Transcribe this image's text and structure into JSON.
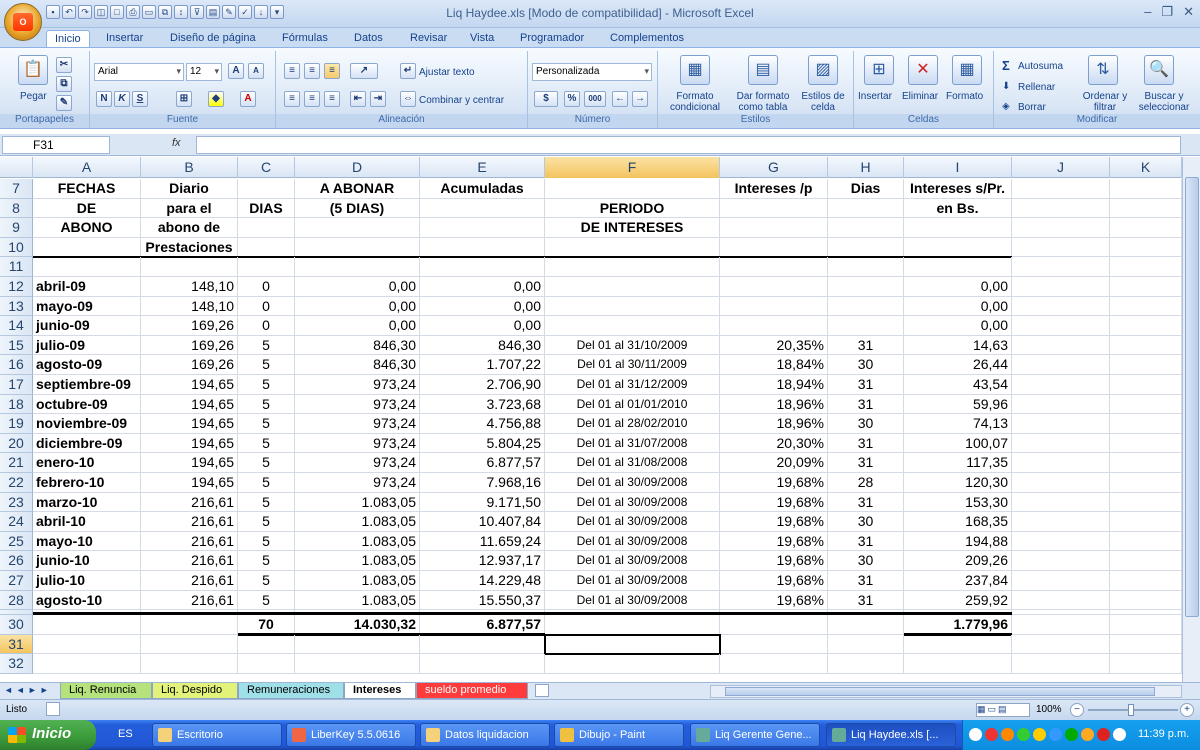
{
  "window": {
    "title": "Liq  Haydee.xls  [Modo de compatibilidad] - Microsoft Excel"
  },
  "ribbon_tabs": [
    "Inicio",
    "Insertar",
    "Diseño de página",
    "Fórmulas",
    "Datos",
    "Revisar",
    "Vista",
    "Programador",
    "Complementos"
  ],
  "ribbon": {
    "portapapeles": {
      "label": "Portapapeles",
      "pegar": "Pegar"
    },
    "fuente": {
      "label": "Fuente",
      "font": "Arial",
      "size": "12",
      "bold": "N",
      "italic": "K",
      "underline": "S"
    },
    "alineacion": {
      "label": "Alineación",
      "ajustar": "Ajustar texto",
      "combinar": "Combinar y centrar"
    },
    "numero": {
      "label": "Número",
      "format": "Personalizada",
      "percent": "%",
      "thousands": "000"
    },
    "estilos": {
      "label": "Estilos",
      "formato_condicional": "Formato condicional",
      "dar_formato": "Dar formato como tabla",
      "estilos_celda": "Estilos de celda"
    },
    "celdas": {
      "label": "Celdas",
      "insertar": "Insertar",
      "eliminar": "Eliminar",
      "formato": "Formato"
    },
    "modificar": {
      "label": "Modificar",
      "autosuma": "Autosuma",
      "rellenar": "Rellenar",
      "borrar": "Borrar",
      "ordenar": "Ordenar y filtrar",
      "buscar": "Buscar y seleccionar"
    }
  },
  "formula_bar": {
    "name_box": "F31",
    "fx": "fx",
    "value": ""
  },
  "columns": [
    "A",
    "B",
    "C",
    "D",
    "E",
    "F",
    "G",
    "H",
    "I",
    "J",
    "K"
  ],
  "selected_column": "F",
  "selected_row": "31",
  "header_rows": [
    {
      "n": "7",
      "A": "FECHAS",
      "B": "Diario",
      "C": "",
      "D": "A ABONAR",
      "E": "Acumuladas",
      "F": "",
      "G": "Intereses /p",
      "H": "Dias",
      "I": "Intereses s/Pr."
    },
    {
      "n": "8",
      "A": "DE",
      "B": "para el",
      "C": "DIAS",
      "D": "(5 DIAS)",
      "E": "",
      "F": "PERIODO",
      "G": "",
      "H": "",
      "I": "en Bs."
    },
    {
      "n": "9",
      "A": "ABONO",
      "B": "abono de",
      "C": "",
      "D": "",
      "E": "",
      "F": "DE INTERESES",
      "G": "",
      "H": "",
      "I": ""
    },
    {
      "n": "10",
      "A": "",
      "B": "Prestaciones",
      "C": "",
      "D": "",
      "E": "",
      "F": "",
      "G": "",
      "H": "",
      "I": ""
    },
    {
      "n": "11",
      "A": "",
      "B": "",
      "C": "",
      "D": "",
      "E": "",
      "F": "",
      "G": "",
      "H": "",
      "I": ""
    }
  ],
  "data_rows": [
    {
      "n": "12",
      "A": "abril-09",
      "B": "148,10",
      "C": "0",
      "D": "0,00",
      "E": "0,00",
      "F": "",
      "G": "",
      "H": "",
      "I": "0,00"
    },
    {
      "n": "13",
      "A": "mayo-09",
      "B": "148,10",
      "C": "0",
      "D": "0,00",
      "E": "0,00",
      "F": "",
      "G": "",
      "H": "",
      "I": "0,00"
    },
    {
      "n": "14",
      "A": "junio-09",
      "B": "169,26",
      "C": "0",
      "D": "0,00",
      "E": "0,00",
      "F": "",
      "G": "",
      "H": "",
      "I": "0,00"
    },
    {
      "n": "15",
      "A": "julio-09",
      "B": "169,26",
      "C": "5",
      "D": "846,30",
      "E": "846,30",
      "F": "Del 01 al 31/10/2009",
      "G": "20,35%",
      "H": "31",
      "I": "14,63"
    },
    {
      "n": "16",
      "A": "agosto-09",
      "B": "169,26",
      "C": "5",
      "D": "846,30",
      "E": "1.707,22",
      "F": "Del 01 al 30/11/2009",
      "G": "18,84%",
      "H": "30",
      "I": "26,44"
    },
    {
      "n": "17",
      "A": "septiembre-09",
      "B": "194,65",
      "C": "5",
      "D": "973,24",
      "E": "2.706,90",
      "F": "Del 01 al 31/12/2009",
      "G": "18,94%",
      "H": "31",
      "I": "43,54"
    },
    {
      "n": "18",
      "A": "octubre-09",
      "B": "194,65",
      "C": "5",
      "D": "973,24",
      "E": "3.723,68",
      "F": "Del 01 al 01/01/2010",
      "G": "18,96%",
      "H": "31",
      "I": "59,96"
    },
    {
      "n": "19",
      "A": "noviembre-09",
      "B": "194,65",
      "C": "5",
      "D": "973,24",
      "E": "4.756,88",
      "F": "Del 01 al 28/02/2010",
      "G": "18,96%",
      "H": "30",
      "I": "74,13"
    },
    {
      "n": "20",
      "A": "diciembre-09",
      "B": "194,65",
      "C": "5",
      "D": "973,24",
      "E": "5.804,25",
      "F": "Del 01 al 31/07/2008",
      "G": "20,30%",
      "H": "31",
      "I": "100,07"
    },
    {
      "n": "21",
      "A": "enero-10",
      "B": "194,65",
      "C": "5",
      "D": "973,24",
      "E": "6.877,57",
      "F": "Del 01 al 31/08/2008",
      "G": "20,09%",
      "H": "31",
      "I": "117,35"
    },
    {
      "n": "22",
      "A": "febrero-10",
      "B": "194,65",
      "C": "5",
      "D": "973,24",
      "E": "7.968,16",
      "F": "Del 01 al 30/09/2008",
      "G": "19,68%",
      "H": "28",
      "I": "120,30"
    },
    {
      "n": "23",
      "A": "marzo-10",
      "B": "216,61",
      "C": "5",
      "D": "1.083,05",
      "E": "9.171,50",
      "F": "Del 01 al 30/09/2008",
      "G": "19,68%",
      "H": "31",
      "I": "153,30"
    },
    {
      "n": "24",
      "A": "abril-10",
      "B": "216,61",
      "C": "5",
      "D": "1.083,05",
      "E": "10.407,84",
      "F": "Del 01 al 30/09/2008",
      "G": "19,68%",
      "H": "30",
      "I": "168,35"
    },
    {
      "n": "25",
      "A": "mayo-10",
      "B": "216,61",
      "C": "5",
      "D": "1.083,05",
      "E": "11.659,24",
      "F": "Del 01 al 30/09/2008",
      "G": "19,68%",
      "H": "31",
      "I": "194,88"
    },
    {
      "n": "26",
      "A": "junio-10",
      "B": "216,61",
      "C": "5",
      "D": "1.083,05",
      "E": "12.937,17",
      "F": "Del 01 al 30/09/2008",
      "G": "19,68%",
      "H": "30",
      "I": "209,26"
    },
    {
      "n": "27",
      "A": "julio-10",
      "B": "216,61",
      "C": "5",
      "D": "1.083,05",
      "E": "14.229,48",
      "F": "Del 01 al 30/09/2008",
      "G": "19,68%",
      "H": "31",
      "I": "237,84"
    },
    {
      "n": "28",
      "A": "agosto-10",
      "B": "216,61",
      "C": "5",
      "D": "1.083,05",
      "E": "15.550,37",
      "F": "Del 01 al 30/09/2008",
      "G": "19,68%",
      "H": "31",
      "I": "259,92"
    }
  ],
  "tail_rows": [
    {
      "n": "30",
      "A": "",
      "B": "",
      "C": "70",
      "D": "14.030,32",
      "E": "6.877,57",
      "F": "",
      "G": "",
      "H": "",
      "I": "1.779,96"
    },
    {
      "n": "31",
      "A": "",
      "B": "",
      "C": "",
      "D": "",
      "E": "",
      "F": "",
      "G": "",
      "H": "",
      "I": ""
    },
    {
      "n": "32",
      "A": "",
      "B": "",
      "C": "",
      "D": "",
      "E": "",
      "F": "",
      "G": "",
      "H": "",
      "I": ""
    }
  ],
  "sheet_tabs": [
    {
      "label": "Liq. Renuncia",
      "color": "#b5e27a"
    },
    {
      "label": "Liq. Despido",
      "color": "#e2f27a"
    },
    {
      "label": "Remuneraciones",
      "color": "#9fe0e8"
    },
    {
      "label": "Intereses",
      "color": "#ffffff"
    },
    {
      "label": "sueldo promedio",
      "color": "#ff3b3b"
    }
  ],
  "status": {
    "ready": "Listo",
    "zoom": "100%"
  },
  "taskbar": {
    "start": "Inicio",
    "lang": "ES",
    "items": [
      "Escritorio",
      "LiberKey 5.5.0616",
      "Datos liquidacion",
      "Dibujo - Paint",
      "Liq  Gerente Gene...",
      "Liq  Haydee.xls  [..."
    ],
    "clock": "11:39 p.m."
  }
}
